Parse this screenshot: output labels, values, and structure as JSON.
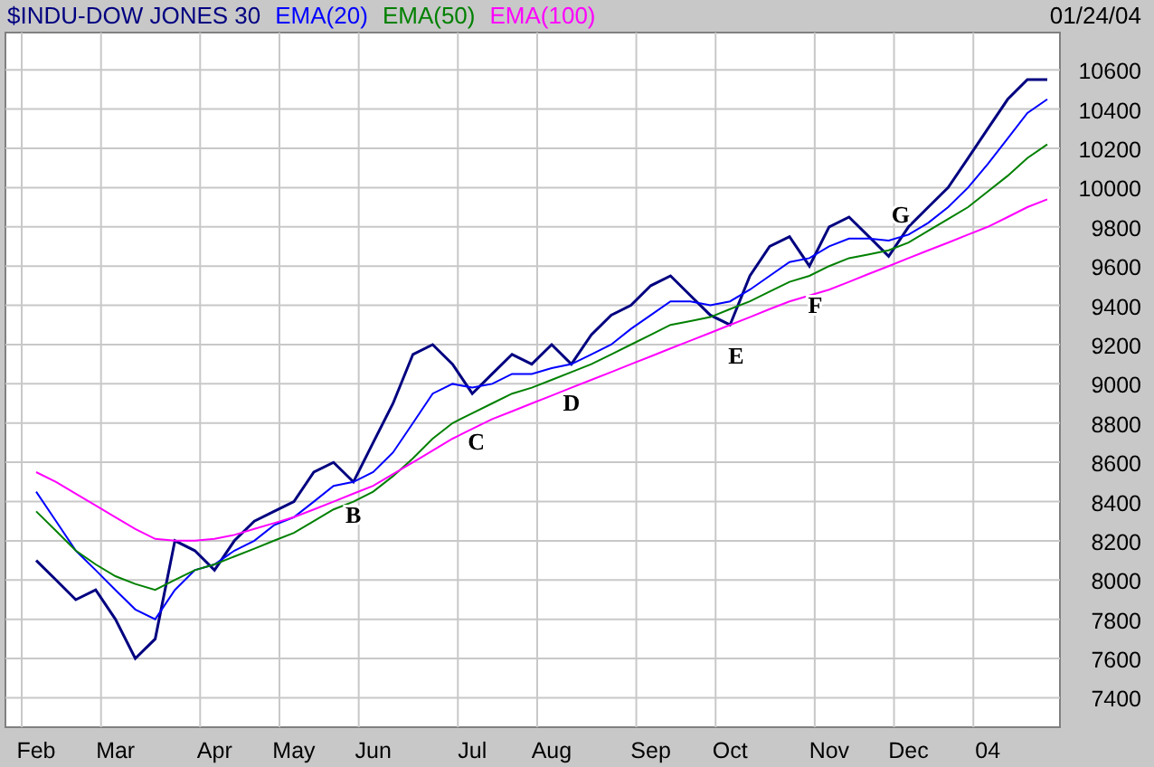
{
  "header": {
    "date": "01/24/04"
  },
  "chart_data": {
    "type": "line",
    "categories": [
      "Feb",
      null,
      null,
      null,
      "Mar",
      null,
      null,
      null,
      null,
      "Apr",
      null,
      null,
      null,
      "May",
      null,
      null,
      null,
      "Jun",
      null,
      null,
      null,
      null,
      "Jul",
      null,
      null,
      null,
      "Aug",
      null,
      null,
      null,
      null,
      "Sep",
      null,
      null,
      null,
      "Oct",
      null,
      null,
      null,
      null,
      "Nov",
      null,
      null,
      null,
      "Dec",
      null,
      null,
      null,
      "04",
      null,
      null,
      null
    ],
    "ylim": [
      7250,
      10790
    ],
    "yticks": [
      7400,
      7600,
      7800,
      8000,
      8200,
      8400,
      8600,
      8800,
      9000,
      9200,
      9400,
      9600,
      9800,
      10000,
      10200,
      10400,
      10600
    ],
    "series": [
      {
        "name": "$INDU-DOW JONES 30",
        "color": "#000080",
        "values": [
          8100,
          8000,
          7900,
          7950,
          7800,
          7600,
          7700,
          8200,
          8150,
          8050,
          8200,
          8300,
          8350,
          8400,
          8550,
          8600,
          8500,
          8700,
          8900,
          9150,
          9200,
          9100,
          8950,
          9050,
          9150,
          9100,
          9200,
          9100,
          9250,
          9350,
          9400,
          9500,
          9550,
          9450,
          9350,
          9300,
          9550,
          9700,
          9750,
          9600,
          9800,
          9850,
          9750,
          9650,
          9800,
          9900,
          10000,
          10150,
          10300,
          10450,
          10550,
          10550
        ]
      },
      {
        "name": "EMA(20)",
        "color": "#0000ff",
        "values": [
          8450,
          8300,
          8150,
          8050,
          7950,
          7850,
          7800,
          7950,
          8050,
          8080,
          8150,
          8200,
          8280,
          8320,
          8400,
          8480,
          8500,
          8550,
          8650,
          8800,
          8950,
          9000,
          8980,
          9000,
          9050,
          9050,
          9080,
          9100,
          9150,
          9200,
          9280,
          9350,
          9420,
          9420,
          9400,
          9420,
          9480,
          9550,
          9620,
          9640,
          9700,
          9740,
          9740,
          9730,
          9760,
          9820,
          9900,
          10000,
          10120,
          10250,
          10380,
          10450
        ]
      },
      {
        "name": "EMA(50)",
        "color": "#008000",
        "values": [
          8350,
          8250,
          8150,
          8080,
          8020,
          7980,
          7950,
          8000,
          8050,
          8080,
          8120,
          8160,
          8200,
          8240,
          8300,
          8360,
          8400,
          8450,
          8530,
          8620,
          8720,
          8800,
          8850,
          8900,
          8950,
          8980,
          9020,
          9060,
          9100,
          9150,
          9200,
          9250,
          9300,
          9320,
          9340,
          9380,
          9420,
          9470,
          9520,
          9550,
          9600,
          9640,
          9660,
          9680,
          9720,
          9780,
          9840,
          9900,
          9980,
          10060,
          10150,
          10220
        ]
      },
      {
        "name": "EMA(100)",
        "color": "#ff00ff",
        "values": [
          8550,
          8500,
          8440,
          8380,
          8320,
          8260,
          8210,
          8200,
          8200,
          8210,
          8230,
          8260,
          8290,
          8320,
          8360,
          8400,
          8440,
          8480,
          8540,
          8600,
          8660,
          8720,
          8770,
          8820,
          8860,
          8900,
          8940,
          8980,
          9020,
          9060,
          9100,
          9140,
          9180,
          9220,
          9260,
          9300,
          9340,
          9380,
          9420,
          9450,
          9480,
          9520,
          9560,
          9600,
          9640,
          9680,
          9720,
          9760,
          9800,
          9850,
          9900,
          9940
        ]
      }
    ],
    "grid": true,
    "annotations": [
      "B",
      "C",
      "D",
      "E",
      "F",
      "G"
    ]
  }
}
